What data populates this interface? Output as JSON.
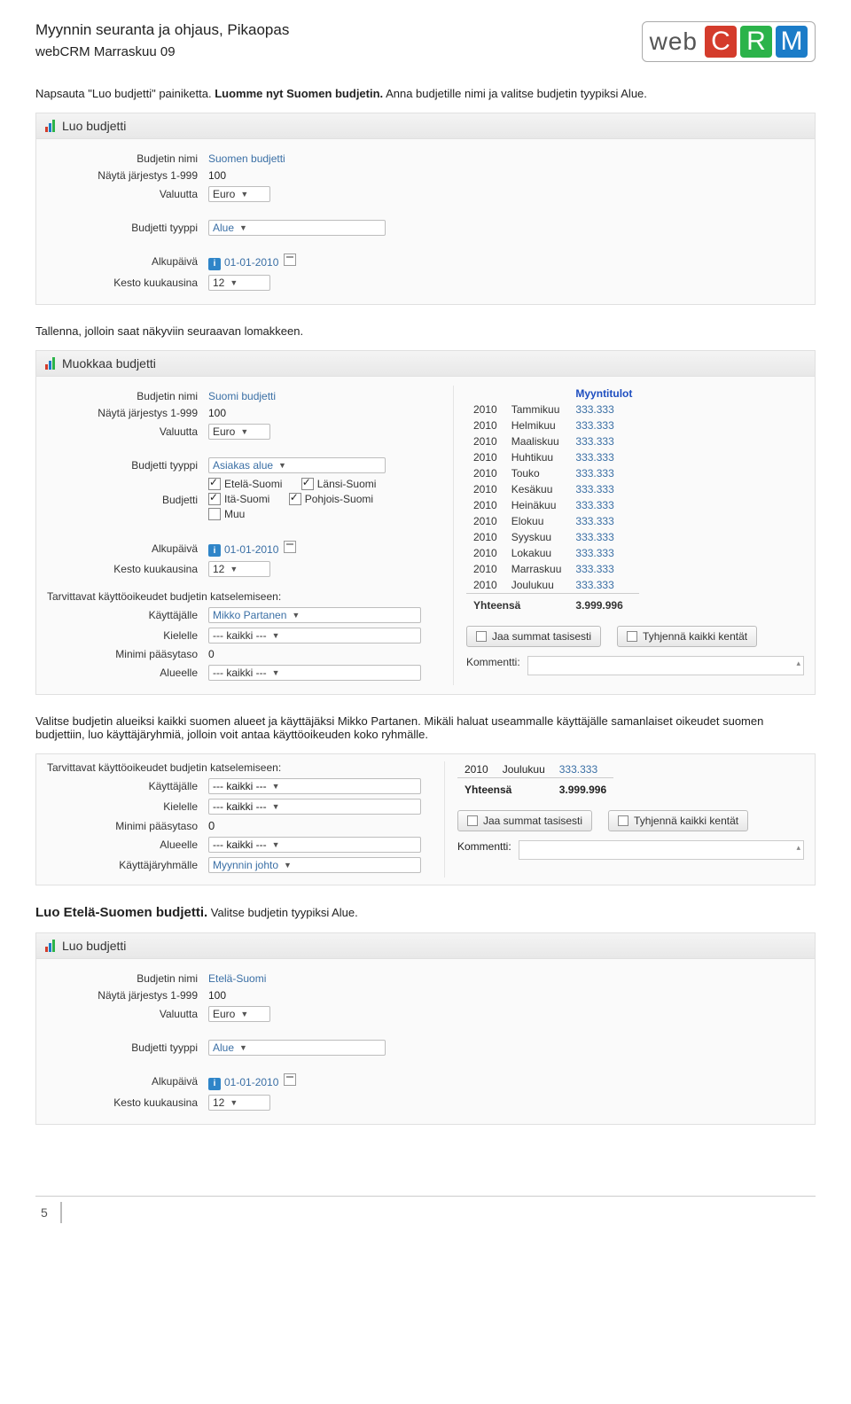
{
  "header": {
    "title1": "Myynnin seuranta ja ohjaus, Pikaopas",
    "title2": "webCRM Marraskuu 09",
    "logo_web": "web",
    "logo_c": "C",
    "logo_r": "R",
    "logo_m": "M"
  },
  "intro1": {
    "pre": "Napsauta \"Luo budjetti\" painiketta. ",
    "bold": "Luomme nyt Suomen budjetin.",
    "post": " Anna budjetille nimi ja valitse budjetin tyypiksi Alue."
  },
  "panel1": {
    "title": "Luo budjetti",
    "fields": {
      "name_lbl": "Budjetin nimi",
      "name_val": "Suomen budjetti",
      "order_lbl": "Näytä järjestys 1-999",
      "order_val": "100",
      "curr_lbl": "Valuutta",
      "curr_val": "Euro",
      "type_lbl": "Budjetti tyyppi",
      "type_val": "Alue",
      "start_lbl": "Alkupäivä",
      "start_val": "01-01-2010",
      "months_lbl": "Kesto kuukausina",
      "months_val": "12"
    }
  },
  "text2": "Tallenna, jolloin saat näkyviin seuraavan lomakkeen.",
  "panel2": {
    "title": "Muokkaa budjetti",
    "left": {
      "name_lbl": "Budjetin nimi",
      "name_val": "Suomi budjetti",
      "order_lbl": "Näytä järjestys 1-999",
      "order_val": "100",
      "curr_lbl": "Valuutta",
      "curr_val": "Euro",
      "type_lbl": "Budjetti tyyppi",
      "type_val": "Asiakas alue",
      "budget_lbl": "Budjetti",
      "cb1": "Etelä-Suomi",
      "cb2": "Itä-Suomi",
      "cb3": "Muu",
      "cb4": "Länsi-Suomi",
      "cb5": "Pohjois-Suomi",
      "start_lbl": "Alkupäivä",
      "start_val": "01-01-2010",
      "months_lbl": "Kesto kuukausina",
      "months_val": "12",
      "perm_note": "Tarvittavat käyttöoikeudet budjetin katselemiseen:",
      "user_lbl": "Käyttäjälle",
      "user_val": "Mikko Partanen",
      "lang_lbl": "Kielelle",
      "lang_val": "--- kaikki ---",
      "min_lbl": "Minimi pääsytaso",
      "min_val": "0",
      "area_lbl": "Alueelle",
      "area_val": "--- kaikki ---"
    },
    "right": {
      "heading": "Myyntitulot",
      "rows": [
        {
          "y": "2010",
          "m": "Tammikuu",
          "v": "333.333"
        },
        {
          "y": "2010",
          "m": "Helmikuu",
          "v": "333.333"
        },
        {
          "y": "2010",
          "m": "Maaliskuu",
          "v": "333.333"
        },
        {
          "y": "2010",
          "m": "Huhtikuu",
          "v": "333.333"
        },
        {
          "y": "2010",
          "m": "Touko",
          "v": "333.333"
        },
        {
          "y": "2010",
          "m": "Kesäkuu",
          "v": "333.333"
        },
        {
          "y": "2010",
          "m": "Heinäkuu",
          "v": "333.333"
        },
        {
          "y": "2010",
          "m": "Elokuu",
          "v": "333.333"
        },
        {
          "y": "2010",
          "m": "Syyskuu",
          "v": "333.333"
        },
        {
          "y": "2010",
          "m": "Lokakuu",
          "v": "333.333"
        },
        {
          "y": "2010",
          "m": "Marraskuu",
          "v": "333.333"
        },
        {
          "y": "2010",
          "m": "Joulukuu",
          "v": "333.333"
        }
      ],
      "total_lbl": "Yhteensä",
      "total_val": "3.999.996",
      "btn1": "Jaa summat tasisesti",
      "btn2": "Tyhjennä kaikki kentät",
      "comment_lbl": "Kommentti:"
    }
  },
  "text3": "Valitse budjetin alueiksi kaikki suomen alueet ja käyttäjäksi Mikko Partanen. Mikäli haluat useammalle käyttäjälle samanlaiset oikeudet suomen budjettiin, luo käyttäjäryhmiä, jolloin voit antaa käyttöoikeuden koko ryhmälle.",
  "snippet": {
    "left": {
      "perm_note": "Tarvittavat käyttöoikeudet budjetin katselemiseen:",
      "user_lbl": "Käyttäjälle",
      "user_val": "--- kaikki ---",
      "lang_lbl": "Kielelle",
      "lang_val": "--- kaikki ---",
      "min_lbl": "Minimi pääsytaso",
      "min_val": "0",
      "area_lbl": "Alueelle",
      "area_val": "--- kaikki ---",
      "group_lbl": "Käyttäjäryhmälle",
      "group_val": "Myynnin johto"
    },
    "right": {
      "lastrow_y": "2010",
      "lastrow_m": "Joulukuu",
      "lastrow_v": "333.333",
      "total_lbl": "Yhteensä",
      "total_val": "3.999.996",
      "btn1": "Jaa summat tasisesti",
      "btn2": "Tyhjennä kaikki kentät",
      "comment_lbl": "Kommentti:"
    }
  },
  "sect3": {
    "title": "Luo Etelä-Suomen budjetti.",
    "rest": " Valitse budjetin tyypiksi Alue."
  },
  "panel3": {
    "title": "Luo budjetti",
    "fields": {
      "name_lbl": "Budjetin nimi",
      "name_val": "Etelä-Suomi",
      "order_lbl": "Näytä järjestys 1-999",
      "order_val": "100",
      "curr_lbl": "Valuutta",
      "curr_val": "Euro",
      "type_lbl": "Budjetti tyyppi",
      "type_val": "Alue",
      "start_lbl": "Alkupäivä",
      "start_val": "01-01-2010",
      "months_lbl": "Kesto kuukausina",
      "months_val": "12"
    }
  },
  "footer": {
    "page": "5"
  }
}
